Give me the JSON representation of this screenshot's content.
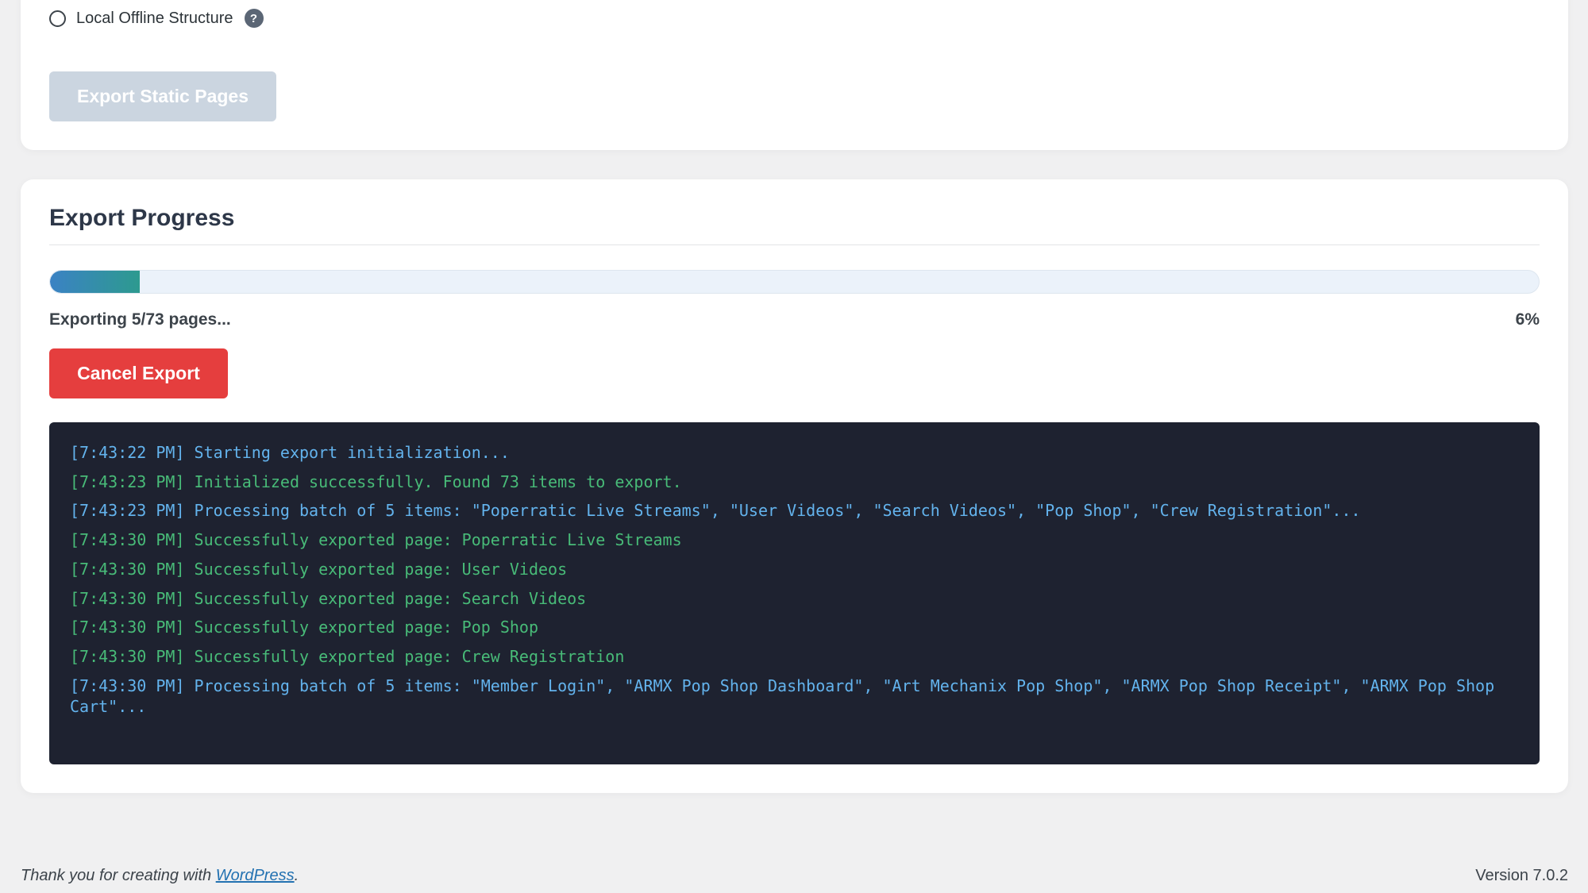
{
  "export_options": {
    "radio_label": "Local Offline Structure",
    "help_icon": "?",
    "export_button_label": "Export Static Pages"
  },
  "progress": {
    "title": "Export Progress",
    "percent_value": 6,
    "status_text": "Exporting 5/73 pages...",
    "percent_text": "6%",
    "cancel_button_label": "Cancel Export",
    "fill_gradient": [
      "#3b82c4",
      "#2d9a8f"
    ]
  },
  "log": {
    "lines": [
      {
        "type": "info",
        "text": "[7:43:22 PM] Starting export initialization..."
      },
      {
        "type": "success",
        "text": "[7:43:23 PM] Initialized successfully. Found 73 items to export."
      },
      {
        "type": "info",
        "text": "[7:43:23 PM] Processing batch of 5 items: \"Poperratic Live Streams\", \"User Videos\", \"Search Videos\", \"Pop Shop\", \"Crew Registration\"..."
      },
      {
        "type": "success",
        "text": "[7:43:30 PM] Successfully exported page: Poperratic Live Streams"
      },
      {
        "type": "success",
        "text": "[7:43:30 PM] Successfully exported page: User Videos"
      },
      {
        "type": "success",
        "text": "[7:43:30 PM] Successfully exported page: Search Videos"
      },
      {
        "type": "success",
        "text": "[7:43:30 PM] Successfully exported page: Pop Shop"
      },
      {
        "type": "success",
        "text": "[7:43:30 PM] Successfully exported page: Crew Registration"
      },
      {
        "type": "info",
        "text": "[7:43:30 PM] Processing batch of 5 items: \"Member Login\", \"ARMX Pop Shop Dashboard\", \"Art Mechanix Pop Shop\", \"ARMX Pop Shop Receipt\", \"ARMX Pop Shop Cart\"..."
      }
    ],
    "colors": {
      "info": "#63b3ed",
      "success": "#48bb78",
      "background": "#1e2230"
    }
  },
  "footer": {
    "thanks_prefix": "Thank you for creating with ",
    "link_text": "WordPress",
    "thanks_suffix": ".",
    "version": "Version 7.0.2"
  },
  "colors": {
    "cancel_red": "#e53e3e",
    "disabled_button": "#cbd5e0",
    "page_background": "#f0f0f1"
  }
}
